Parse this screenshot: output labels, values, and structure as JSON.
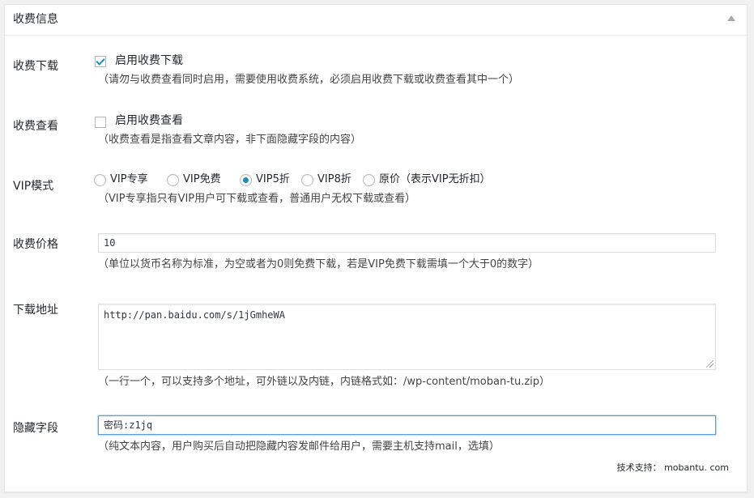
{
  "panel": {
    "title": "收费信息"
  },
  "fields": {
    "download": {
      "label": "收费下载",
      "checkbox_label": "启用收费下载",
      "checked": true,
      "desc": "（请勿与收费查看同时启用，需要使用收费系统，必须启用收费下载或收费查看其中一个）"
    },
    "view": {
      "label": "收费查看",
      "checkbox_label": "启用收费查看",
      "checked": false,
      "desc": "（收费查看是指查看文章内容，非下面隐藏字段的内容）"
    },
    "vip": {
      "label": "VIP模式",
      "options": [
        "VIP专享",
        "VIP免费",
        "VIP5折",
        "VIP8折",
        "原价（表示VIP无折扣）"
      ],
      "selected": "VIP5折",
      "desc": "（VIP专享指只有VIP用户可下载或查看，普通用户无权下载或查看）"
    },
    "price": {
      "label": "收费价格",
      "value": "10",
      "desc": "（单位以货币名称为标准，为空或者为0则免费下载，若是VIP免费下载需填一个大于0的数字）"
    },
    "url": {
      "label": "下载地址",
      "value": "http://pan.baidu.com/s/1jGmheWA",
      "desc": "（一行一个，可以支持多个地址，可外链以及内链，内链格式如：/wp-content/moban-tu.zip）"
    },
    "hidden": {
      "label": "隐藏字段",
      "value": "密码:z1jq",
      "desc": "（纯文本内容，用户购买后自动把隐藏内容发邮件给用户，需要主机支持mail，选填）"
    }
  },
  "footer": {
    "text": "技术支持： mobantu. com"
  },
  "colors": {
    "accent": "#1e8cbe",
    "border": "#dddddd",
    "background": "#f1f1f1"
  }
}
